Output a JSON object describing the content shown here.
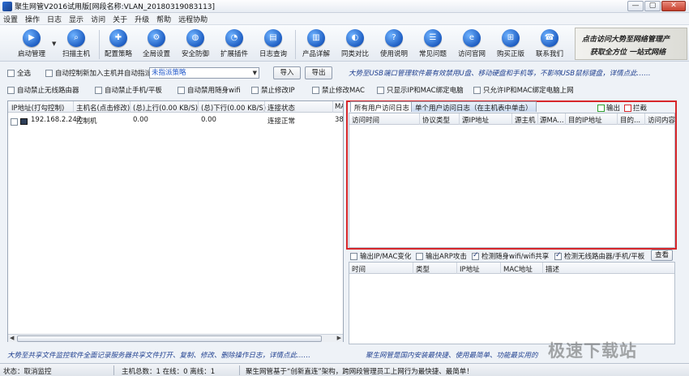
{
  "window": {
    "title": "聚生网管V2016试用版[网段名称:VLAN_20180319083113]",
    "controls": [
      "—",
      "▢",
      "✕"
    ]
  },
  "menu": [
    "设置",
    "操作",
    "日志",
    "显示",
    "访问",
    "关于",
    "升级",
    "帮助",
    "远程协助"
  ],
  "toolbar": {
    "items": [
      {
        "label": "启动管理",
        "icon": "play-icon"
      },
      {
        "label": "扫描主机",
        "icon": "magnifier-icon"
      },
      {
        "label": "配置策略",
        "icon": "policy-icon"
      },
      {
        "label": "全局设置",
        "icon": "gear-icon"
      },
      {
        "label": "安全防御",
        "icon": "globe-shield-icon"
      },
      {
        "label": "扩展插件",
        "icon": "pie-icon"
      },
      {
        "label": "日志查询",
        "icon": "document-icon"
      },
      {
        "label": "产品详解",
        "icon": "bars-icon"
      },
      {
        "label": "同类对比",
        "icon": "gauge-icon"
      },
      {
        "label": "使用说明",
        "icon": "help-icon"
      },
      {
        "label": "常见问题",
        "icon": "chat-icon"
      },
      {
        "label": "访问官网",
        "icon": "browser-icon"
      },
      {
        "label": "购买正版",
        "icon": "cart-icon"
      },
      {
        "label": "联系我们",
        "icon": "contact-icon"
      }
    ],
    "banner": {
      "line1": "点击访问大势至网络管理产",
      "line2": "获取全方位 一站式网络"
    }
  },
  "options_row1": {
    "select_all": "全选",
    "auto_control_new_host": "自动控制新加入主机并自动指派",
    "strategy_value": "未指派策略",
    "import_button": "导入",
    "export_button": "导出"
  },
  "ticker_top": "大势至USB端口管理软件最有效禁用U盘、移动硬盘和手机等，不影响USB鼠标键盘，详情点此……",
  "options_row2": [
    {
      "label": "自动禁止无线路由器",
      "checked": false
    },
    {
      "label": "自动禁止手机/平板",
      "checked": false
    },
    {
      "label": "自动禁用随身wifi",
      "checked": false
    },
    {
      "label": "禁止修改IP",
      "checked": false
    },
    {
      "label": "禁止修改MAC",
      "checked": false
    },
    {
      "label": "只显示IP和MAC绑定电脑",
      "checked": false
    },
    {
      "label": "只允许IP和MAC绑定电脑上网",
      "checked": false
    }
  ],
  "host_table": {
    "columns": [
      "IP地址(打勾控制)",
      "主机名(点击修改)",
      "(总)上行(0.00 KB/S)",
      "(总)下行(0.00 KB/S)",
      "连接状态",
      "MA"
    ],
    "rows": [
      {
        "ip": "192.168.2.247",
        "host": "控制机",
        "up": "0.00",
        "down": "0.00",
        "status": "连接正常",
        "mac": "38"
      }
    ]
  },
  "log_tabs": {
    "tab_all": "所有用户访问日志",
    "tab_single": "单个用户访问日志（在主机表中单击）",
    "legend_output": "输出",
    "legend_block": "拦截",
    "colors": {
      "output": "#2e9e2e",
      "block": "#d7262a"
    }
  },
  "log_table": {
    "columns": [
      "访问时间",
      "协议类型",
      "源IP地址",
      "源主机",
      "源MA...",
      "目的IP地址",
      "目的...",
      "访问内容"
    ]
  },
  "scan_options": {
    "items": [
      {
        "label": "输出IP/MAC变化",
        "checked": false
      },
      {
        "label": "输出ARP攻击",
        "checked": false
      },
      {
        "label": "检测随身wifi/wifi共享",
        "checked": true
      },
      {
        "label": "检测无线路由器/手机/平板",
        "checked": true
      }
    ],
    "view_button": "查看"
  },
  "scan_table": {
    "columns": [
      "时间",
      "类型",
      "IP地址",
      "MAC地址",
      "描述"
    ]
  },
  "footer": {
    "left": "大势至共享文件监控软件全面记录服务器共享文件打开、复制、修改、删除操作日志，详情点此……",
    "right": "聚生网管是国内安装最快捷、使用最简单、功能最实用的"
  },
  "statusbar": {
    "state": "状态：取消监控",
    "counts": "主机总数：1   在线：0   离线：1",
    "message": "聚生网管基于“创新直连”架构，跨网段管理员工上网行为最快捷、最简单！"
  },
  "watermark": "极速下载站"
}
